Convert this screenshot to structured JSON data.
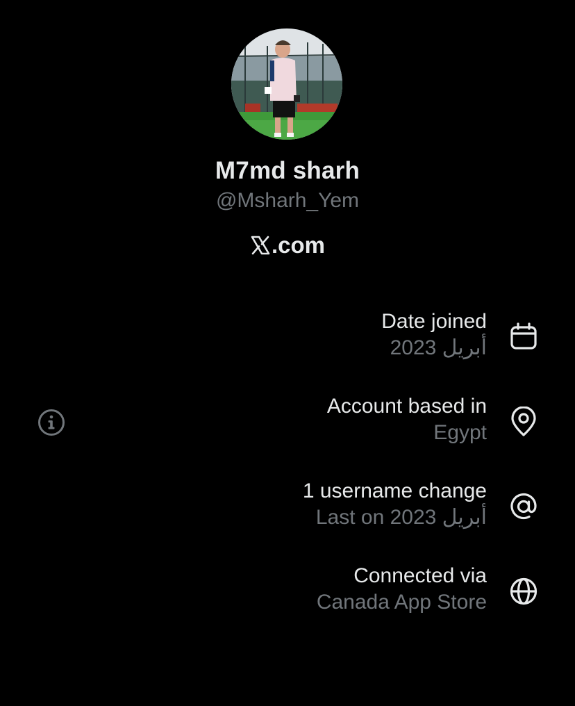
{
  "profile": {
    "display_name": "M7md sharh",
    "handle": "@Msharh_Yem",
    "site_text": ".com",
    "site_logo": "x-logo-icon"
  },
  "details": [
    {
      "title": "Date joined",
      "value": "أبريل 2023",
      "icon": "calendar-icon"
    },
    {
      "title": "Account based in",
      "value": "Egypt",
      "icon": "location-pin-icon"
    },
    {
      "title": "1 username change",
      "value": "Last on أبريل 2023",
      "icon": "at-sign-icon"
    },
    {
      "title": "Connected via",
      "value": "Canada App Store",
      "icon": "globe-icon"
    }
  ],
  "colors": {
    "background": "#000000",
    "primary_text": "#e7e9ea",
    "secondary_text": "#71767b",
    "icon": "#e7e9ea",
    "info_icon": "#71767b"
  },
  "info_button_icon": "info-icon"
}
